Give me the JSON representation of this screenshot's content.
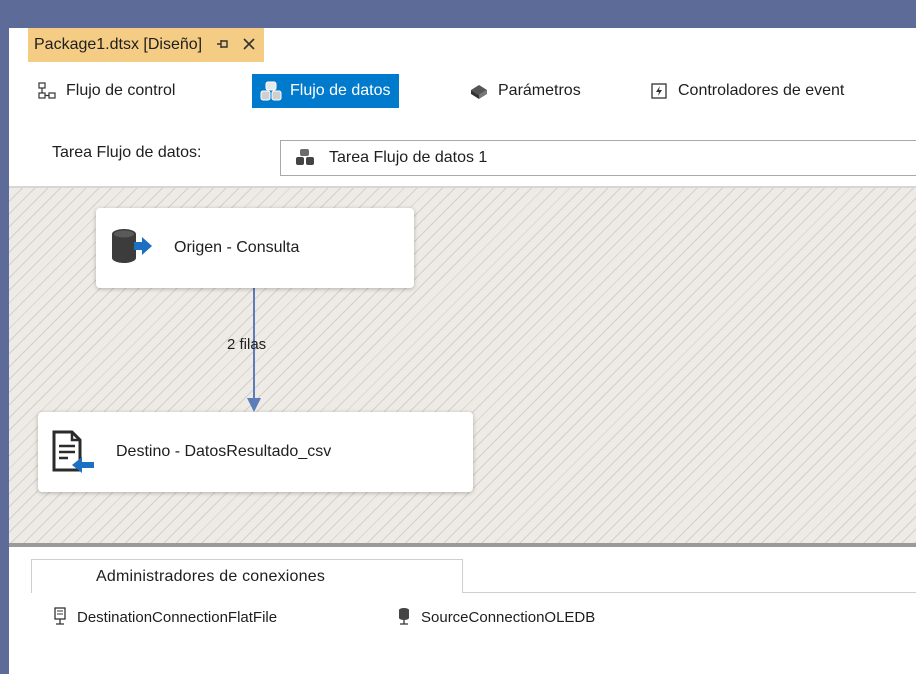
{
  "document_tab": {
    "title": "Package1.dtsx [Diseño]",
    "pin_glyph": "⊕",
    "close_glyph": "✕"
  },
  "designer_tabs": [
    {
      "label": "Flujo de control",
      "icon": "control-flow-icon",
      "active": false
    },
    {
      "label": "Flujo de datos",
      "icon": "data-flow-icon",
      "active": true
    },
    {
      "label": "Parámetros",
      "icon": "parameters-icon",
      "active": false
    },
    {
      "label": "Controladores de event",
      "icon": "event-handlers-icon",
      "active": false
    }
  ],
  "task_selector": {
    "label": "Tarea Flujo de datos:",
    "value": "Tarea Flujo de datos 1"
  },
  "canvas": {
    "source_component": {
      "label": "Origen - Consulta",
      "icon": "database-source-icon"
    },
    "destination_component": {
      "label": "Destino - DatosResultado_csv",
      "icon": "flat-file-destination-icon"
    },
    "path_label": "2 filas"
  },
  "connection_managers": {
    "tab_label": "Administradores de conexiones",
    "items": [
      {
        "label": "DestinationConnectionFlatFile",
        "icon": "flat-file-connection-icon"
      },
      {
        "label": "SourceConnectionOLEDB",
        "icon": "oledb-connection-icon"
      }
    ]
  },
  "colors": {
    "frame": "#5d6b99",
    "doc_tab": "#f5cc84",
    "active_tab": "#007acc",
    "path_arrow": "#5b7db8",
    "canvas": "#eeebe6"
  }
}
